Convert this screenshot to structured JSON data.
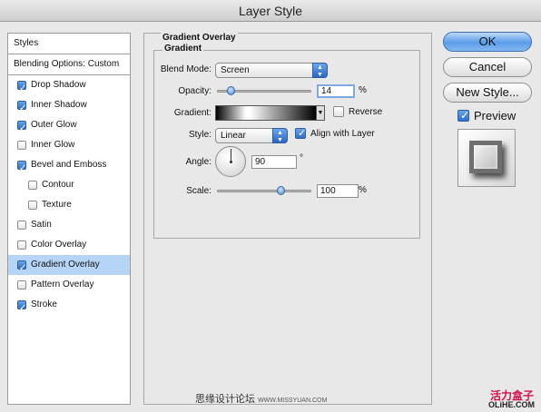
{
  "window": {
    "title": "Layer Style"
  },
  "sidebar": {
    "header": "Styles",
    "blending": "Blending Options: Custom",
    "items": [
      {
        "label": "Drop Shadow",
        "checked": true,
        "sub": false,
        "selected": false
      },
      {
        "label": "Inner Shadow",
        "checked": true,
        "sub": false,
        "selected": false
      },
      {
        "label": "Outer Glow",
        "checked": true,
        "sub": false,
        "selected": false
      },
      {
        "label": "Inner Glow",
        "checked": false,
        "sub": false,
        "selected": false
      },
      {
        "label": "Bevel and Emboss",
        "checked": true,
        "sub": false,
        "selected": false
      },
      {
        "label": "Contour",
        "checked": false,
        "sub": true,
        "selected": false
      },
      {
        "label": "Texture",
        "checked": false,
        "sub": true,
        "selected": false
      },
      {
        "label": "Satin",
        "checked": false,
        "sub": false,
        "selected": false
      },
      {
        "label": "Color Overlay",
        "checked": false,
        "sub": false,
        "selected": false
      },
      {
        "label": "Gradient Overlay",
        "checked": true,
        "sub": false,
        "selected": true
      },
      {
        "label": "Pattern Overlay",
        "checked": false,
        "sub": false,
        "selected": false
      },
      {
        "label": "Stroke",
        "checked": true,
        "sub": false,
        "selected": false
      }
    ]
  },
  "panel": {
    "title": "Gradient Overlay",
    "group_title": "Gradient",
    "blend_mode": {
      "label": "Blend Mode:",
      "value": "Screen"
    },
    "opacity": {
      "label": "Opacity:",
      "value": "14",
      "unit": "%",
      "level": 0.14
    },
    "gradient": {
      "label": "Gradient:",
      "reverse_label": "Reverse",
      "reverse_checked": false
    },
    "style": {
      "label": "Style:",
      "value": "Linear",
      "align_label": "Align with Layer",
      "align_checked": true
    },
    "angle": {
      "label": "Angle:",
      "value": "90",
      "unit": "°"
    },
    "scale": {
      "label": "Scale:",
      "value": "100",
      "unit": "%",
      "level": 0.67
    }
  },
  "buttons": {
    "ok": "OK",
    "cancel": "Cancel",
    "new_style": "New Style...",
    "preview_label": "Preview",
    "preview_checked": true
  },
  "watermark": {
    "center_cn": "思缘设计论坛",
    "center_url": "WWW.MISSYUAN.COM",
    "right_top": "活力盒子",
    "right_bottom": "OLiHE.COM"
  },
  "colors": {
    "accent": "#2c66c2",
    "selected_row": "#b6d4f5",
    "watermark_red": "#d0104c"
  }
}
